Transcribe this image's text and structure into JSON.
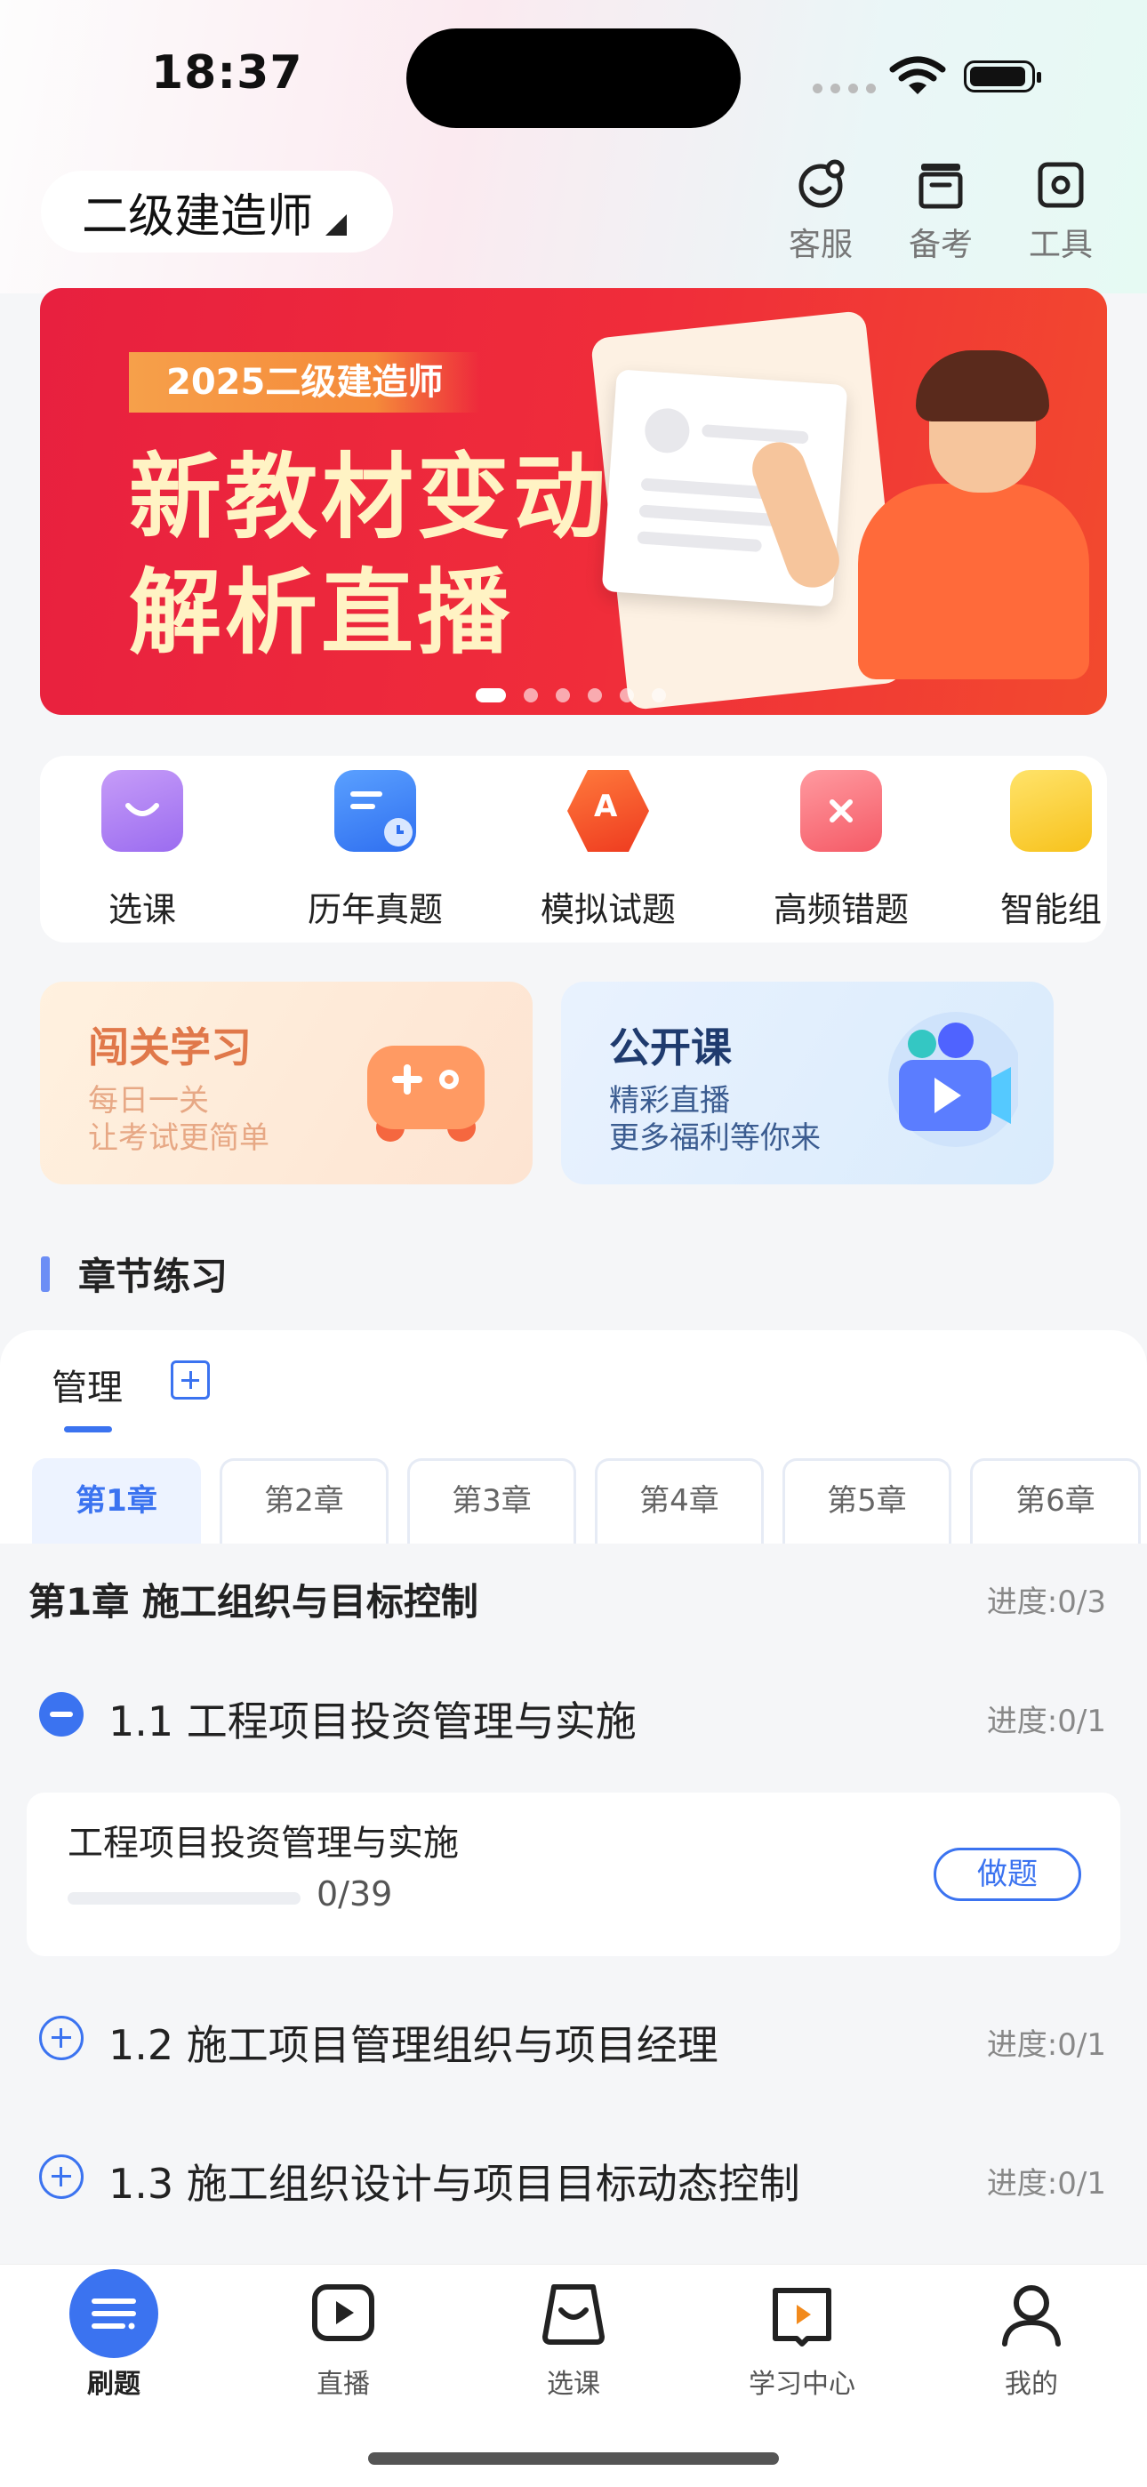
{
  "status_bar": {
    "time": "18:37"
  },
  "header": {
    "exam_name": "二级建造师",
    "tools": [
      {
        "label": "客服",
        "icon": "customer-service-icon"
      },
      {
        "label": "备考",
        "icon": "archive-icon"
      },
      {
        "label": "工具",
        "icon": "tools-icon"
      }
    ]
  },
  "banner": {
    "tag": "2025二级建造师",
    "line1": "新教材变动",
    "line2": "解析直播",
    "page_count": 6,
    "active_page": 1
  },
  "quick_entries": [
    {
      "label": "选课",
      "icon": "shopping-bag-icon"
    },
    {
      "label": "历年真题",
      "icon": "past-papers-icon"
    },
    {
      "label": "模拟试题",
      "icon": "mock-exam-icon"
    },
    {
      "label": "高频错题",
      "icon": "wrong-questions-icon"
    },
    {
      "label": "智能组",
      "icon": "smart-paper-icon"
    }
  ],
  "promo_cards": [
    {
      "title": "闯关学习",
      "line1": "每日一关",
      "line2": "让考试更简单"
    },
    {
      "title": "公开课",
      "line1": "精彩直播",
      "line2": "更多福利等你来"
    }
  ],
  "section_title": "章节练习",
  "practice": {
    "subject_tab": "管理",
    "chapters": [
      "第1章",
      "第2章",
      "第3章",
      "第4章",
      "第5章",
      "第6章"
    ],
    "active_chapter": 0,
    "chapter_title": "第1章 施工组织与目标控制",
    "chapter_progress": "进度:0/3",
    "sections": [
      {
        "name": "1.1 工程项目投资管理与实施",
        "progress": "进度:0/1",
        "expanded": true
      },
      {
        "name": "1.2 施工项目管理组织与项目经理",
        "progress": "进度:0/1",
        "expanded": false
      },
      {
        "name": "1.3 施工组织设计与项目目标动态控制",
        "progress": "进度:0/1",
        "expanded": false
      }
    ],
    "sub_item": {
      "name": "工程项目投资管理与实施",
      "count": "0/39",
      "progress_fraction": 0,
      "button": "做题"
    }
  },
  "tabbar": [
    {
      "label": "刷题",
      "icon": "practice-icon",
      "active": true
    },
    {
      "label": "直播",
      "icon": "live-icon",
      "active": false
    },
    {
      "label": "选课",
      "icon": "course-bag-icon",
      "active": false
    },
    {
      "label": "学习中心",
      "icon": "study-center-icon",
      "active": false
    },
    {
      "label": "我的",
      "icon": "profile-icon",
      "active": false
    }
  ],
  "colors": {
    "accent": "#3b73f0",
    "banner_red": "#e8203f"
  }
}
